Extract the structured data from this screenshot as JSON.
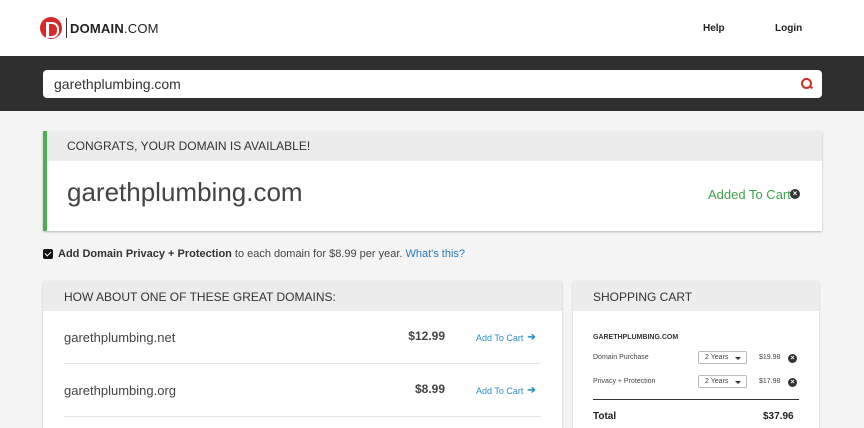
{
  "header": {
    "logo_brand": "DOMAIN",
    "logo_tld": ".COM",
    "nav_help": "Help",
    "nav_login": "Login"
  },
  "search": {
    "value": "garethplumbing.com"
  },
  "available": {
    "heading": "CONGRATS, YOUR DOMAIN IS AVAILABLE!",
    "domain": "garethplumbing.com",
    "status": "Added To Cart",
    "remove_symbol": "×"
  },
  "privacy": {
    "checked": true,
    "bold_text": "Add Domain Privacy + Protection",
    "text": "to each domain for $8.99 per year.",
    "link": "What's this?"
  },
  "suggestions": {
    "heading": "HOW ABOUT ONE OF THESE GREAT DOMAINS:",
    "items": [
      {
        "name": "garethplumbing.net",
        "price": "$12.99",
        "action": "Add To Cart",
        "arrow": "➔"
      },
      {
        "name": "garethplumbing.org",
        "price": "$8.99",
        "action": "Add To Cart",
        "arrow": "➔"
      }
    ]
  },
  "cart": {
    "heading": "SHOPPING CART",
    "domain": "GARETHPLUMBING.COM",
    "lines": [
      {
        "label": "Domain Purchase",
        "term": "2 Years",
        "price": "$19.98",
        "remove_symbol": "×"
      },
      {
        "label": "Privacy + Protection",
        "term": "2 Years",
        "price": "$17.98",
        "remove_symbol": "×"
      }
    ],
    "total_label": "Total",
    "total_value": "$37.96"
  },
  "colors": {
    "brand_red": "#d62a2a",
    "success_green": "#3fa04f",
    "link_blue": "#2b8ec3",
    "search_band": "#2f2f2f"
  }
}
